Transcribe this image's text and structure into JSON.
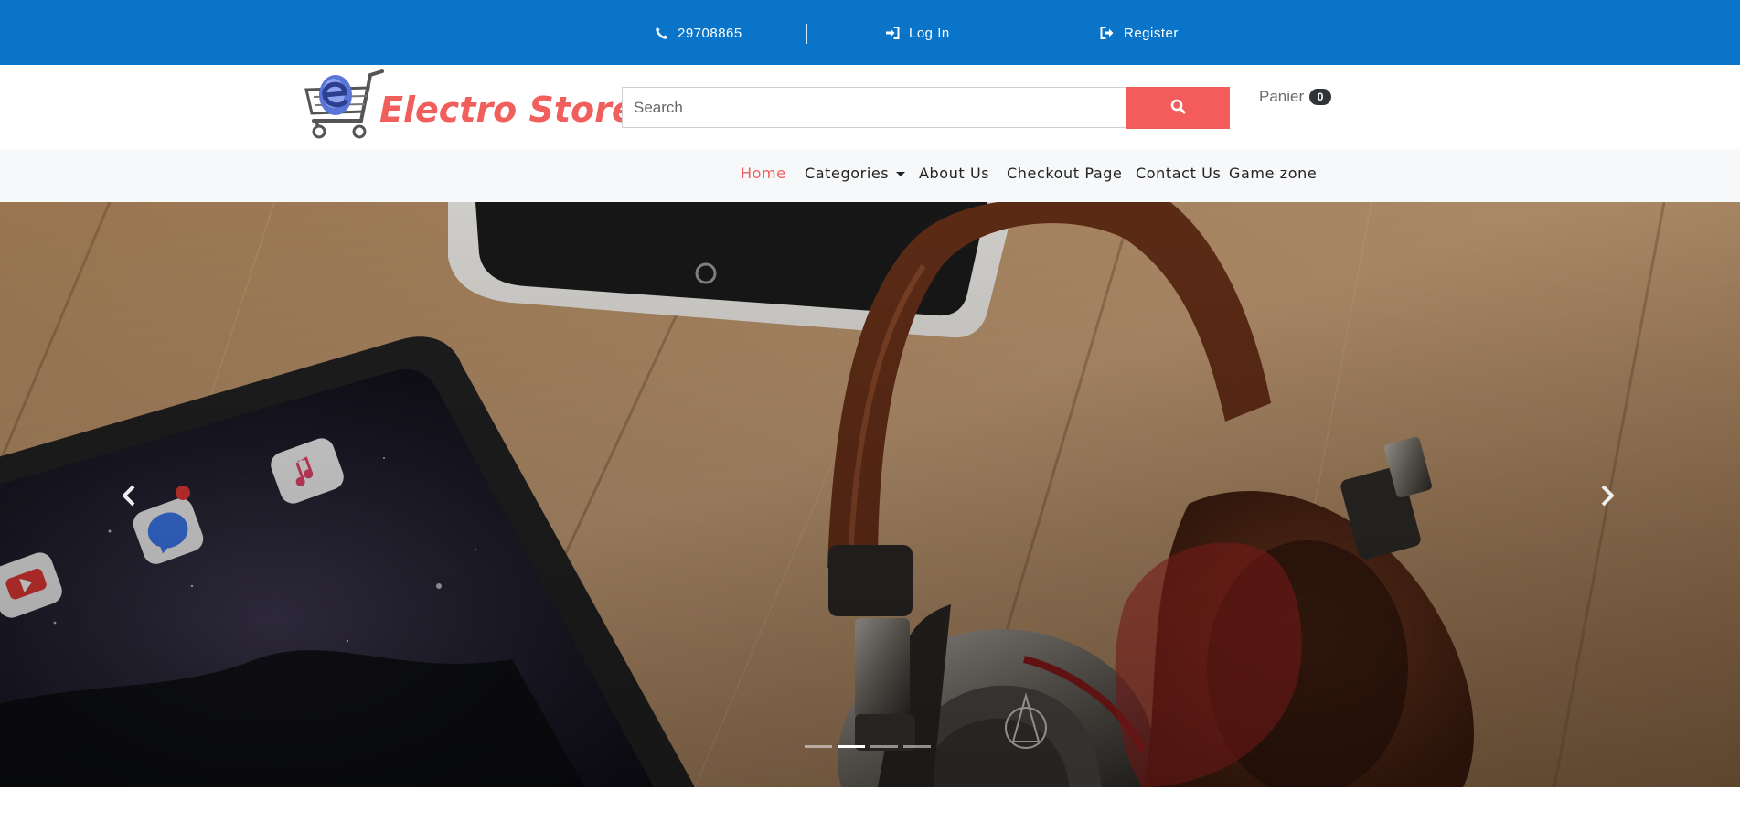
{
  "topbar": {
    "phone": "29708865",
    "login": "Log In",
    "register": "Register",
    "phone_icon": "phone-icon",
    "login_icon": "sign-in-icon",
    "register_icon": "sign-out-icon",
    "bg_color": "#0a74c8"
  },
  "header": {
    "brand": "Electro Store",
    "brand_color": "#f05f5c",
    "search_placeholder": "Search",
    "search_icon": "search-icon",
    "cart_label": "Panier",
    "cart_count": "0"
  },
  "nav": {
    "items": [
      {
        "label": "Home",
        "active": true
      },
      {
        "label": "Categories",
        "dropdown": true
      },
      {
        "label": "About Us"
      },
      {
        "label": "Checkout Page"
      },
      {
        "label": "Contact Us"
      },
      {
        "label": "Game zone"
      }
    ],
    "active_color": "#f05f5c"
  },
  "carousel": {
    "slide_count": 4,
    "active_index": 1,
    "prev_icon": "chevron-left-icon",
    "next_icon": "chevron-right-icon",
    "headphone_brand": "audio-technica",
    "app_labels": [
      "YouTube",
      "Messenger",
      "Music"
    ]
  }
}
